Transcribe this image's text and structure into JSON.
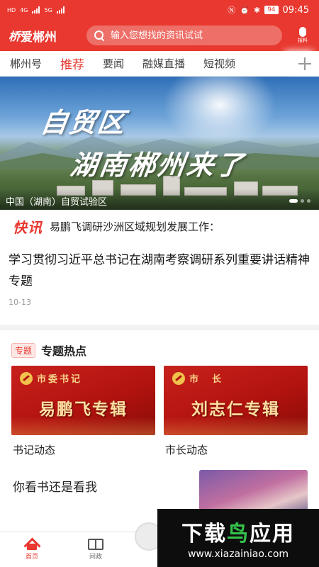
{
  "status_bar": {
    "network_left": "HD",
    "network_mid": "4G",
    "network_right": "5G",
    "battery": "94",
    "time": "09:45"
  },
  "header": {
    "logo_mark": "桥",
    "logo_text": "爱郴州",
    "search_placeholder": "输入您想找的资讯试试",
    "report_label": "报料"
  },
  "tabs": [
    {
      "label": "郴州号"
    },
    {
      "label": "推荐",
      "active": true
    },
    {
      "label": "要闻"
    },
    {
      "label": "融媒直播"
    },
    {
      "label": "短视频"
    }
  ],
  "banner": {
    "title_line1": "自贸区",
    "title_line2": "湖南郴州来了",
    "caption": "中国（湖南）自贸试验区"
  },
  "flash": {
    "logo": "快讯",
    "text": "易鹏飞调研沙洲区域规划发展工作："
  },
  "article": {
    "title": "学习贯彻习近平总书记在湖南考察调研系列重要讲话精神专题",
    "date": "10-13"
  },
  "topics": {
    "badge": "专题",
    "title": "专题热点",
    "cards": [
      {
        "role": "市委书记",
        "name": "易鹏飞专辑",
        "label": "书记动态"
      },
      {
        "role": "市　长",
        "name": "刘志仁专辑",
        "label": "市长动态"
      }
    ]
  },
  "feed": {
    "item_title": "你看书还是看我"
  },
  "bottom_nav": {
    "home": "首页",
    "politics": "问政"
  },
  "watermark": {
    "title_part1": "下载",
    "title_part2": "鸟",
    "title_part3": "应用",
    "url": "www.xiazainiao.com"
  },
  "colors": {
    "brand_red": "#e8382f",
    "watermark_green": "#35c24b"
  }
}
